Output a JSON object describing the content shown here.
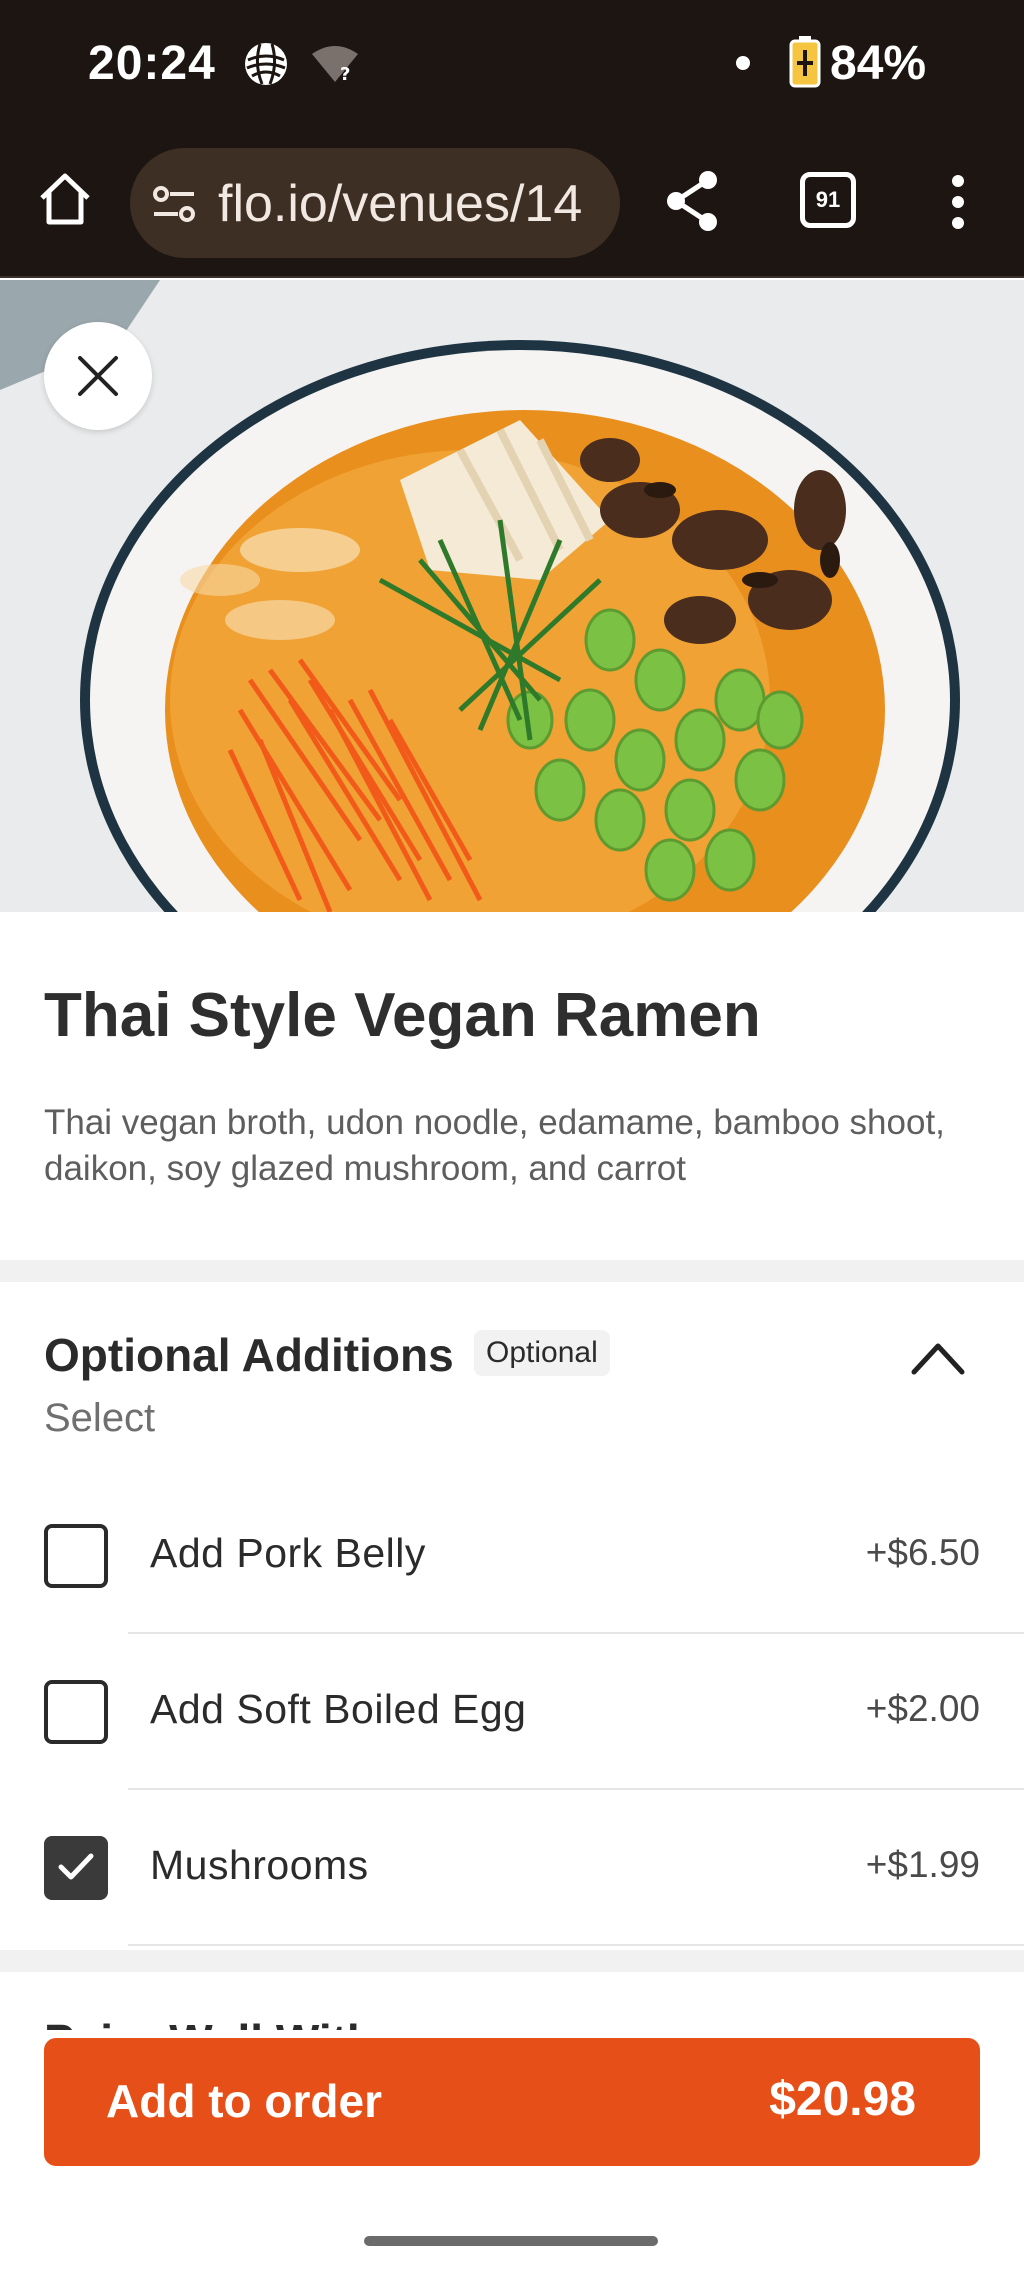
{
  "status_bar": {
    "time": "20:24",
    "battery_percent": "84%",
    "wifi_badge": "?",
    "icons": [
      "globe-icon",
      "wifi-question-icon",
      "notification-dot-icon",
      "battery-charging-icon"
    ]
  },
  "browser": {
    "url": "flo.io/venues/14",
    "tab_count": "91",
    "icons": [
      "home-icon",
      "site-settings-icon",
      "share-icon",
      "tabs-icon",
      "more-vert-icon"
    ]
  },
  "hero": {
    "icons": [
      "close-icon"
    ]
  },
  "item": {
    "title": "Thai Style Vegan Ramen",
    "description": "Thai vegan broth, udon noodle, edamame, bamboo shoot, daikon, soy glazed mushroom, and carrot"
  },
  "section": {
    "title": "Optional Additions",
    "badge": "Optional",
    "subtitle": "Select",
    "expanded": true,
    "options": [
      {
        "label": "Add Pork Belly",
        "price": "+$6.50",
        "checked": false
      },
      {
        "label": "Add Soft Boiled Egg",
        "price": "+$2.00",
        "checked": false
      },
      {
        "label": "Mushrooms",
        "price": "+$1.99",
        "checked": true
      }
    ]
  },
  "next_section": {
    "title_partial": "Pairs Well With"
  },
  "cta": {
    "label": "Add to order",
    "price": "$20.98"
  },
  "colors": {
    "status_bg": "#1d1511",
    "url_pill": "#3e2f24",
    "accent": "#e64f18",
    "checked_box": "#3a3a3a"
  }
}
